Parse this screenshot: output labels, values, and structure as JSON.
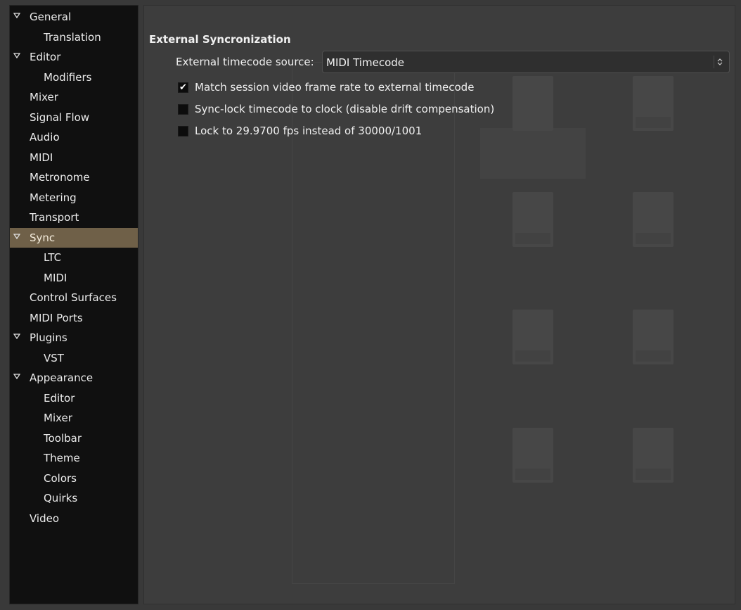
{
  "sidebar": {
    "items": [
      {
        "label": "General",
        "level": 0,
        "expander": true
      },
      {
        "label": "Translation",
        "level": 1
      },
      {
        "label": "Editor",
        "level": 0,
        "expander": true
      },
      {
        "label": "Modifiers",
        "level": 1
      },
      {
        "label": "Mixer",
        "level": 0
      },
      {
        "label": "Signal Flow",
        "level": 0
      },
      {
        "label": "Audio",
        "level": 0
      },
      {
        "label": "MIDI",
        "level": 0
      },
      {
        "label": "Metronome",
        "level": 0
      },
      {
        "label": "Metering",
        "level": 0
      },
      {
        "label": "Transport",
        "level": 0
      },
      {
        "label": "Sync",
        "level": 0,
        "expander": true,
        "selected": true
      },
      {
        "label": "LTC",
        "level": 1
      },
      {
        "label": "MIDI",
        "level": 1
      },
      {
        "label": "Control Surfaces",
        "level": 0
      },
      {
        "label": "MIDI Ports",
        "level": 0
      },
      {
        "label": "Plugins",
        "level": 0,
        "expander": true
      },
      {
        "label": "VST",
        "level": 1
      },
      {
        "label": "Appearance",
        "level": 0,
        "expander": true
      },
      {
        "label": "Editor",
        "level": 1
      },
      {
        "label": "Mixer",
        "level": 1
      },
      {
        "label": "Toolbar",
        "level": 1
      },
      {
        "label": "Theme",
        "level": 1
      },
      {
        "label": "Colors",
        "level": 1
      },
      {
        "label": "Quirks",
        "level": 1
      },
      {
        "label": "Video",
        "level": 0
      }
    ],
    "icons": {
      "expander": "triangle-down-icon"
    }
  },
  "main": {
    "section_title": "External Syncronization",
    "timecode_source_label": "External timecode source:",
    "timecode_source_value": "MIDI Timecode",
    "combo_icon": "spinner-updown-icon",
    "checks": [
      {
        "label": "Match session video frame rate to external timecode",
        "checked": true
      },
      {
        "label": "Sync-lock timecode to clock (disable drift compensation)",
        "checked": false
      },
      {
        "label": "Lock to 29.9700 fps instead of 30000/1001",
        "checked": false
      }
    ]
  },
  "colors": {
    "sidebar_bg": "#101010",
    "selected_bg": "#6f6048",
    "panel_bg": "#3d3d3d"
  }
}
